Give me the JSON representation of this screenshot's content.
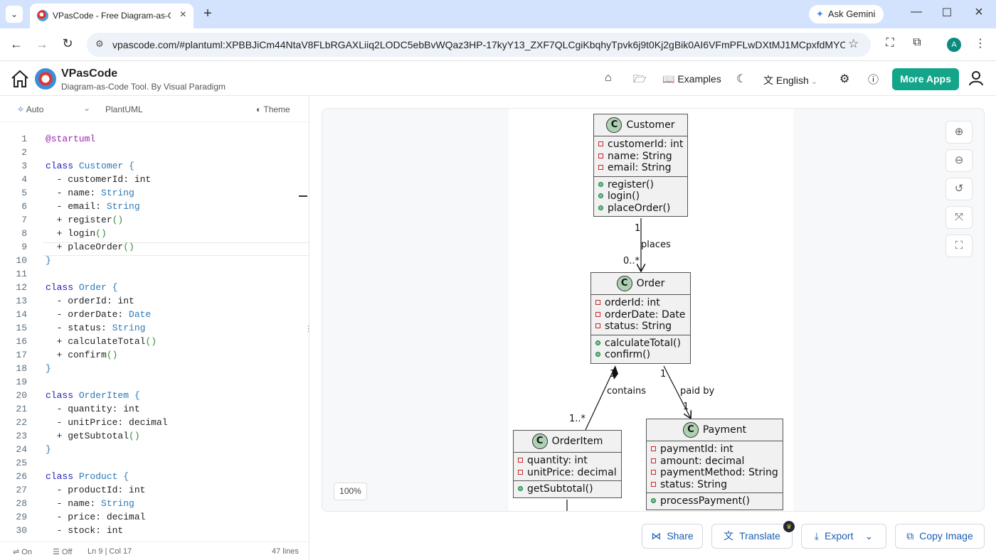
{
  "browser": {
    "tab_title": "VPasCode - Free Diagram-as-Co",
    "url": "vpascode.com/#plantuml:XPBBJiCm44NtaV8FLbRGAXLiiq2LODC5ebBvWQaz3HP-17kyY13_ZXF7QLCgiKbqhyTpvk6j9t0Kj2gBik0AI6VFmPFLwDXtMJ1MCpxfdMYOD9H...",
    "gemini_label": "Ask Gemini",
    "profile_initial": "A"
  },
  "app": {
    "brand": "VPasCode",
    "tagline": "Diagram-as-Code Tool. By Visual Paradigm",
    "examples_label": "Examples",
    "language_label": "English",
    "more_apps_label": "More Apps"
  },
  "editor": {
    "mode_label": "Auto",
    "language_label": "PlantUML",
    "theme_label": "Theme",
    "lines": [
      {
        "n": "1",
        "t": "@startuml"
      },
      {
        "n": "2",
        "t": ""
      },
      {
        "n": "3",
        "t": "class Customer {"
      },
      {
        "n": "4",
        "t": "  - customerId: int"
      },
      {
        "n": "5",
        "t": "  - name: String"
      },
      {
        "n": "6",
        "t": "  - email: String"
      },
      {
        "n": "7",
        "t": "  + register()"
      },
      {
        "n": "8",
        "t": "  + login()"
      },
      {
        "n": "9",
        "t": "  + placeOrder()"
      },
      {
        "n": "10",
        "t": "}"
      },
      {
        "n": "11",
        "t": ""
      },
      {
        "n": "12",
        "t": "class Order {"
      },
      {
        "n": "13",
        "t": "  - orderId: int"
      },
      {
        "n": "14",
        "t": "  - orderDate: Date"
      },
      {
        "n": "15",
        "t": "  - status: String"
      },
      {
        "n": "16",
        "t": "  + calculateTotal()"
      },
      {
        "n": "17",
        "t": "  + confirm()"
      },
      {
        "n": "18",
        "t": "}"
      },
      {
        "n": "19",
        "t": ""
      },
      {
        "n": "20",
        "t": "class OrderItem {"
      },
      {
        "n": "21",
        "t": "  - quantity: int"
      },
      {
        "n": "22",
        "t": "  - unitPrice: decimal"
      },
      {
        "n": "23",
        "t": "  + getSubtotal()"
      },
      {
        "n": "24",
        "t": "}"
      },
      {
        "n": "25",
        "t": ""
      },
      {
        "n": "26",
        "t": "class Product {"
      },
      {
        "n": "27",
        "t": "  - productId: int"
      },
      {
        "n": "28",
        "t": "  - name: String"
      },
      {
        "n": "29",
        "t": "  - price: decimal"
      },
      {
        "n": "30",
        "t": "  - stock: int"
      }
    ],
    "status": {
      "wrap_label": "On",
      "fold_label": "Off",
      "cursor": "Ln 9 | Col 17",
      "line_count": "47 lines"
    }
  },
  "diagram": {
    "zoom": "100%",
    "classes": {
      "customer": {
        "name": "Customer",
        "attributes": [
          "customerId: int",
          "name: String",
          "email: String"
        ],
        "methods": [
          "register()",
          "login()",
          "placeOrder()"
        ]
      },
      "order": {
        "name": "Order",
        "attributes": [
          "orderId: int",
          "orderDate: Date",
          "status: String"
        ],
        "methods": [
          "calculateTotal()",
          "confirm()"
        ]
      },
      "orderitem": {
        "name": "OrderItem",
        "attributes": [
          "quantity: int",
          "unitPrice: decimal"
        ],
        "methods": [
          "getSubtotal()"
        ]
      },
      "payment": {
        "name": "Payment",
        "attributes": [
          "paymentId: int",
          "amount: decimal",
          "paymentMethod: String",
          "status: String"
        ],
        "methods": [
          "processPayment()"
        ]
      }
    },
    "relations": {
      "places": {
        "label": "places",
        "from_mult": "1",
        "to_mult": "0..*"
      },
      "contains": {
        "label": "contains",
        "from_mult": "1",
        "to_mult": "1..*"
      },
      "paid_by": {
        "label": "paid by",
        "from_mult": "1",
        "to_mult": "1"
      }
    }
  },
  "actions": {
    "share": "Share",
    "translate": "Translate",
    "export": "Export",
    "copy_image": "Copy Image"
  }
}
